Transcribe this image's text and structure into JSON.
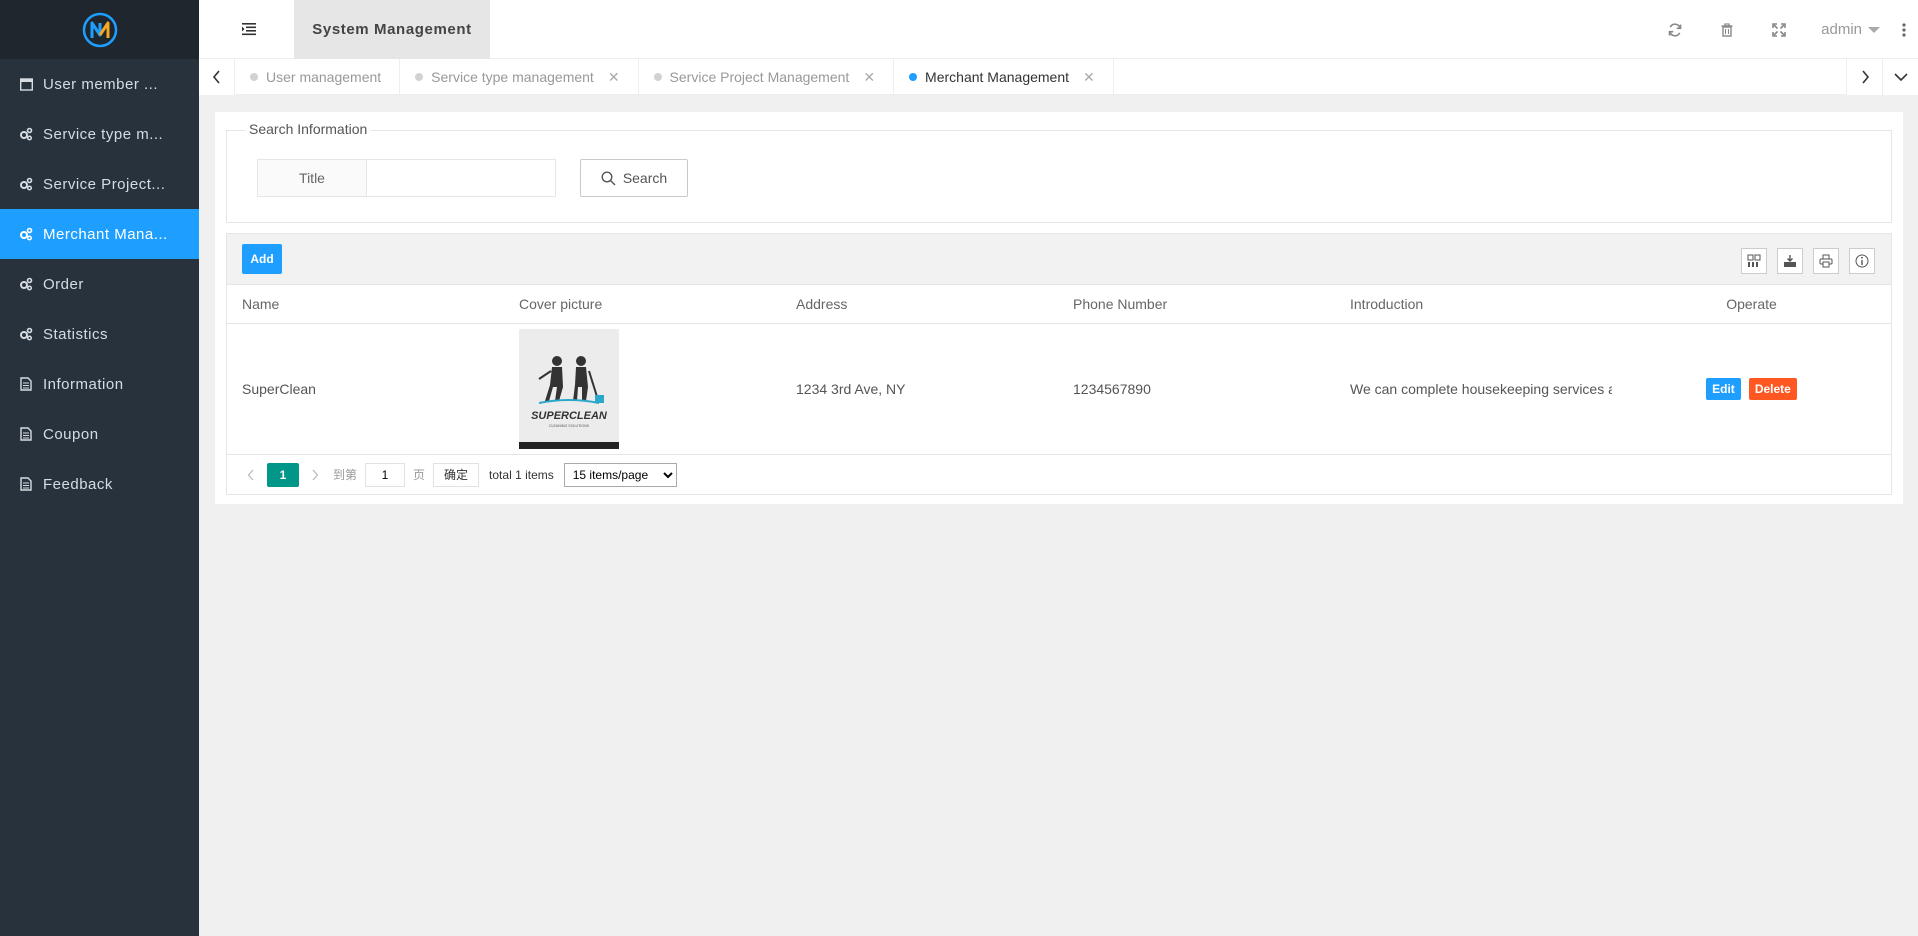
{
  "app": {
    "title": "System Management",
    "user": "admin",
    "accent": "#1e9fff"
  },
  "sidebar": {
    "items": [
      {
        "label": "User member ...",
        "icon": "window-icon"
      },
      {
        "label": "Service type m...",
        "icon": "gears-icon"
      },
      {
        "label": "Service Project...",
        "icon": "gears-icon"
      },
      {
        "label": "Merchant Mana...",
        "icon": "gears-icon",
        "active": true
      },
      {
        "label": "Order",
        "icon": "gears-icon"
      },
      {
        "label": "Statistics",
        "icon": "gears-icon"
      },
      {
        "label": "Information",
        "icon": "file-icon"
      },
      {
        "label": "Coupon",
        "icon": "file-icon"
      },
      {
        "label": "Feedback",
        "icon": "file-icon"
      }
    ]
  },
  "tabs": [
    {
      "label": "User management",
      "closable": false
    },
    {
      "label": "Service type management",
      "closable": true
    },
    {
      "label": "Service Project Management",
      "closable": true
    },
    {
      "label": "Merchant Management",
      "closable": true,
      "active": true
    }
  ],
  "search": {
    "legend": "Search Information",
    "title_label": "Title",
    "title_value": "",
    "button": "Search"
  },
  "table": {
    "add_label": "Add",
    "columns": [
      "Name",
      "Cover picture",
      "Address",
      "Phone Number",
      "Introduction",
      "Operate"
    ],
    "rows": [
      {
        "name": "SuperClean",
        "cover_text": "SUPERCLEAN",
        "cover_sub": "CLEANING SOLUTIONS",
        "address": "1234 3rd Ave, NY",
        "phone": "1234567890",
        "intro": "We can complete housekeeping services a",
        "edit": "Edit",
        "delete": "Delete"
      }
    ]
  },
  "pager": {
    "current": "1",
    "goto_label": "到第",
    "goto_value": "1",
    "page_label": "页",
    "ok_label": "确定",
    "total": "total 1 items",
    "page_size": "15 items/page"
  }
}
